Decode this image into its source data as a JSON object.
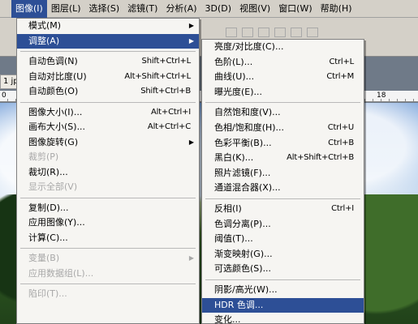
{
  "menubar": {
    "items": [
      {
        "label": "图像(I)",
        "active": true
      },
      {
        "label": "图层(L)"
      },
      {
        "label": "选择(S)"
      },
      {
        "label": "滤镜(T)"
      },
      {
        "label": "分析(A)"
      },
      {
        "label": "3D(D)"
      },
      {
        "label": "视图(V)"
      },
      {
        "label": "窗口(W)"
      },
      {
        "label": "帮助(H)"
      }
    ]
  },
  "doc": {
    "tab_label": "1 jp",
    "ruler_left": "0",
    "ruler_right": "18"
  },
  "image_menu": {
    "groups": [
      [
        {
          "label": "模式(M)",
          "submenu": true
        },
        {
          "label": "调整(A)",
          "submenu": true,
          "highlight": true
        }
      ],
      [
        {
          "label": "自动色调(N)",
          "shortcut": "Shift+Ctrl+L"
        },
        {
          "label": "自动对比度(U)",
          "shortcut": "Alt+Shift+Ctrl+L"
        },
        {
          "label": "自动颜色(O)",
          "shortcut": "Shift+Ctrl+B"
        }
      ],
      [
        {
          "label": "图像大小(I)...",
          "shortcut": "Alt+Ctrl+I"
        },
        {
          "label": "画布大小(S)...",
          "shortcut": "Alt+Ctrl+C"
        },
        {
          "label": "图像旋转(G)",
          "submenu": true
        },
        {
          "label": "裁剪(P)",
          "disabled": true
        },
        {
          "label": "裁切(R)..."
        },
        {
          "label": "显示全部(V)",
          "disabled": true
        }
      ],
      [
        {
          "label": "复制(D)..."
        },
        {
          "label": "应用图像(Y)..."
        },
        {
          "label": "计算(C)..."
        }
      ],
      [
        {
          "label": "变量(B)",
          "submenu": true,
          "disabled": true
        },
        {
          "label": "应用数据组(L)...",
          "disabled": true
        }
      ],
      [
        {
          "label": "陷印(T)...",
          "disabled": true
        }
      ]
    ]
  },
  "adjust_menu": {
    "groups": [
      [
        {
          "label": "亮度/对比度(C)..."
        },
        {
          "label": "色阶(L)...",
          "shortcut": "Ctrl+L"
        },
        {
          "label": "曲线(U)...",
          "shortcut": "Ctrl+M"
        },
        {
          "label": "曝光度(E)..."
        }
      ],
      [
        {
          "label": "自然饱和度(V)..."
        },
        {
          "label": "色相/饱和度(H)...",
          "shortcut": "Ctrl+U"
        },
        {
          "label": "色彩平衡(B)...",
          "shortcut": "Ctrl+B"
        },
        {
          "label": "黑白(K)...",
          "shortcut": "Alt+Shift+Ctrl+B"
        },
        {
          "label": "照片滤镜(F)..."
        },
        {
          "label": "通道混合器(X)..."
        }
      ],
      [
        {
          "label": "反相(I)",
          "shortcut": "Ctrl+I"
        },
        {
          "label": "色调分离(P)..."
        },
        {
          "label": "阈值(T)..."
        },
        {
          "label": "渐变映射(G)..."
        },
        {
          "label": "可选颜色(S)..."
        }
      ],
      [
        {
          "label": "阴影/高光(W)..."
        },
        {
          "label": "HDR 色调...",
          "highlight": true
        },
        {
          "label": "变化..."
        }
      ]
    ]
  },
  "colors": {
    "highlight": "#2d4f96",
    "menu_bg": "#f6f5f2",
    "disabled": "#a8a8a8"
  }
}
